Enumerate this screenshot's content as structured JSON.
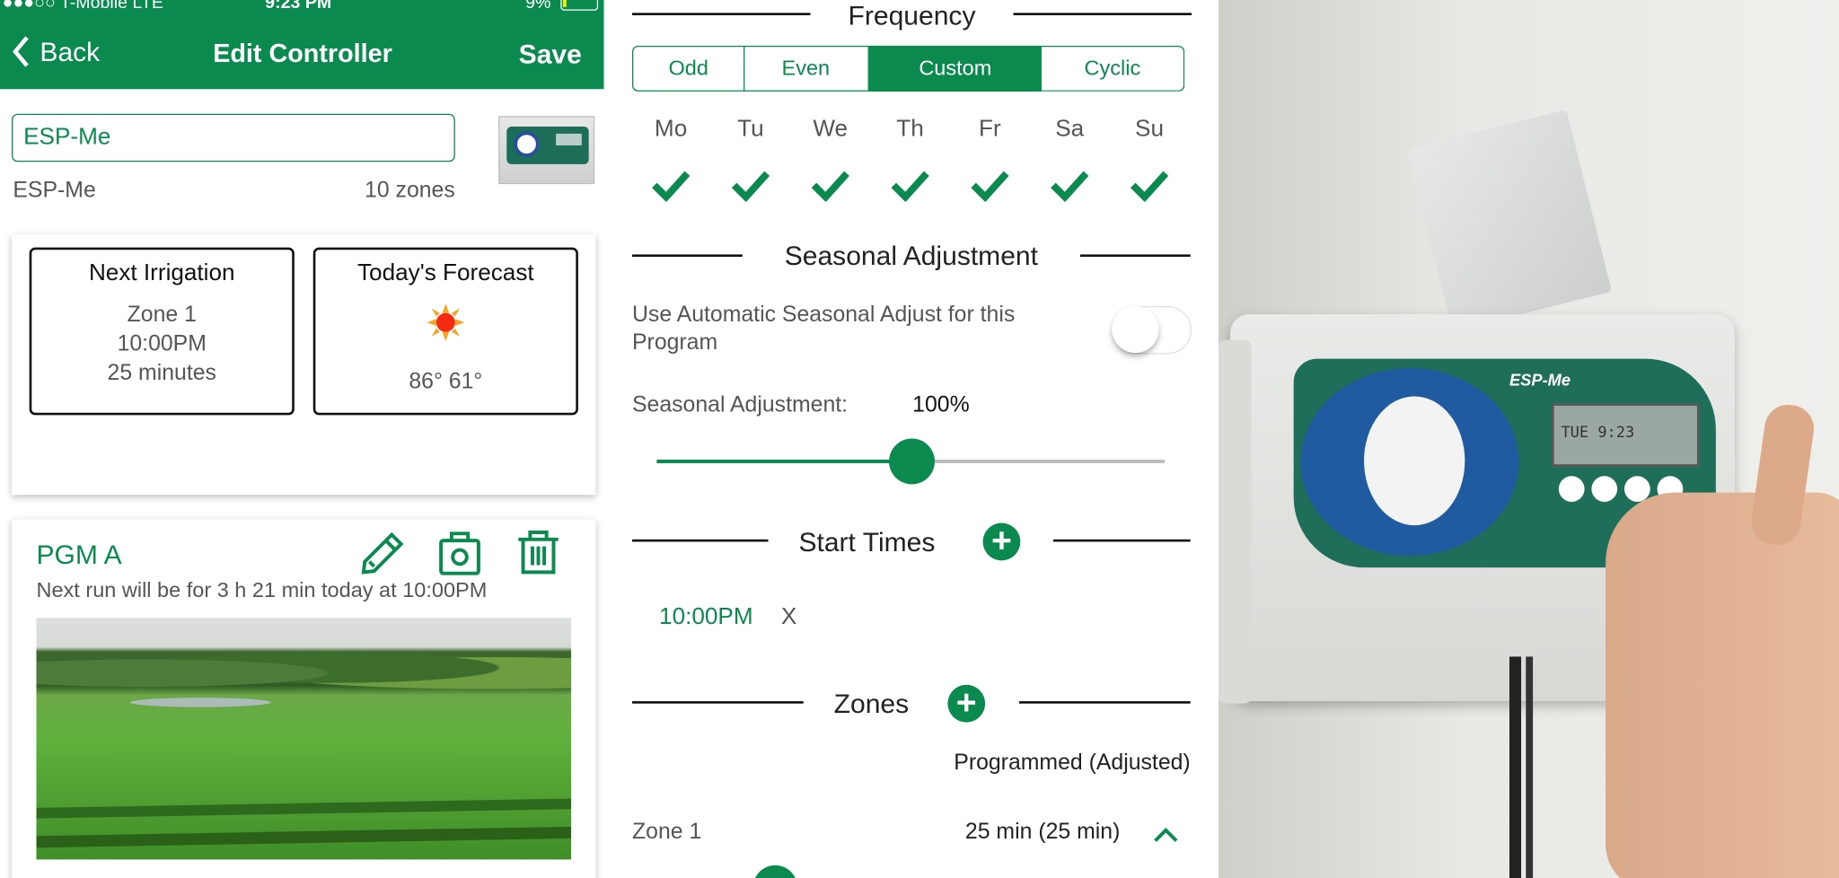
{
  "status_bar": {
    "carrier": "●●●○○ T-Mobile  LTE",
    "time": "9:23 PM",
    "battery": "9%"
  },
  "nav": {
    "back_label": "Back",
    "title": "Edit Controller",
    "save_label": "Save"
  },
  "controller": {
    "name_value": "ESP-Me",
    "model": "ESP-Me",
    "zones": "10 zones"
  },
  "next_irrigation": {
    "title": "Next Irrigation",
    "zone": "Zone 1",
    "time": "10:00PM",
    "duration": "25 minutes"
  },
  "forecast": {
    "title": "Today's Forecast",
    "icon": "sun-icon",
    "temps": "86° 61°"
  },
  "tabs": [
    {
      "icon": "home-icon",
      "selected": true
    },
    {
      "icon": "partly-cloudy-icon"
    },
    {
      "icon": "wifi-icon"
    },
    {
      "icon": "sprinkler-icon"
    },
    {
      "icon": "no-water-icon"
    }
  ],
  "program": {
    "name": "PGM A",
    "next_run": "Next run will be for 3 h 21 min today at 10:00PM",
    "actions": [
      "edit-icon",
      "camera-icon",
      "trash-icon"
    ]
  },
  "frequency": {
    "heading": "Frequency",
    "options": [
      "Odd",
      "Even",
      "Custom",
      "Cyclic"
    ],
    "selected": "Custom",
    "days": [
      "Mo",
      "Tu",
      "We",
      "Th",
      "Fr",
      "Sa",
      "Su"
    ],
    "days_checked": [
      true,
      true,
      true,
      true,
      true,
      true,
      true
    ]
  },
  "seasonal": {
    "heading": "Seasonal Adjustment",
    "auto_label": "Use Automatic Seasonal Adjust for this Program",
    "auto_enabled": false,
    "label": "Seasonal Adjustment:",
    "value": "100%",
    "value_percent": 100
  },
  "start_times": {
    "heading": "Start Times",
    "items": [
      {
        "time": "10:00PM",
        "remove": "X"
      }
    ]
  },
  "zones": {
    "heading": "Zones",
    "column_header": "Programmed (Adjusted)",
    "items": [
      {
        "name": "Zone 1",
        "duration": "25 min (25 min)"
      }
    ]
  },
  "colors": {
    "brand_green": "#0a8a4e"
  },
  "photo": {
    "device_label": "ESP-Me",
    "display_text": "TUE 9:23"
  }
}
